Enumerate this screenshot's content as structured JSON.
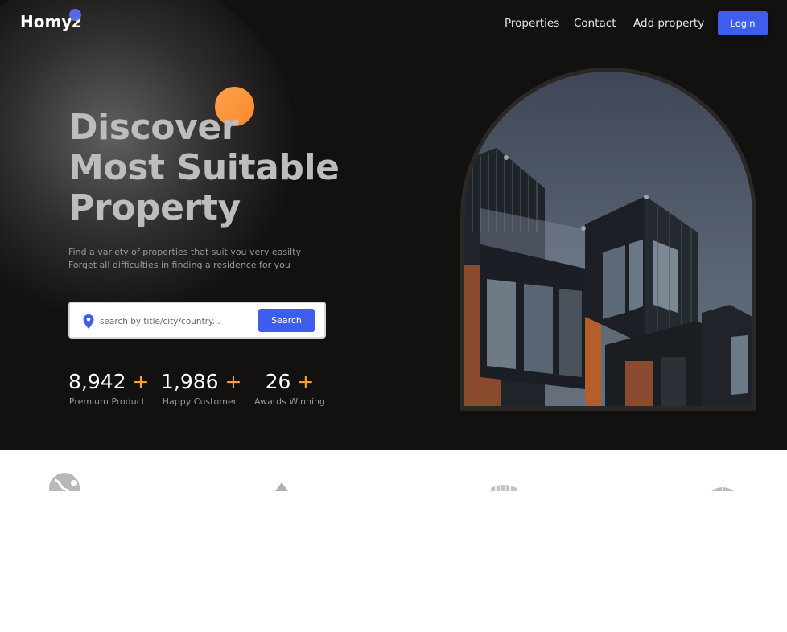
{
  "header": {
    "logo": "Homyz",
    "nav": [
      "Properties",
      "Contact",
      "Add property"
    ],
    "login_label": "Login"
  },
  "hero": {
    "title_lines": [
      "Discover",
      "Most Suitable",
      "Property"
    ],
    "subtitle_lines": [
      "Find a variety of properties that suit you very easilty",
      "Forget all difficulties in finding a residence for you"
    ],
    "search": {
      "placeholder": "search by title/city/country...",
      "button_label": "Search"
    },
    "stats": [
      {
        "value": "8,942",
        "plus": "+",
        "label": "Premium Product"
      },
      {
        "value": "1,986",
        "plus": "+",
        "label": "Happy Customer"
      },
      {
        "value": "26",
        "plus": "+",
        "label": "Awards Winning"
      }
    ]
  },
  "colors": {
    "accent_blue": "#3d5ded",
    "orange": "#f9a03f",
    "hero_bg": "#131110"
  },
  "partners": [
    "globe-logo",
    "triangle-logo",
    "building-logo",
    "dome-logo"
  ]
}
